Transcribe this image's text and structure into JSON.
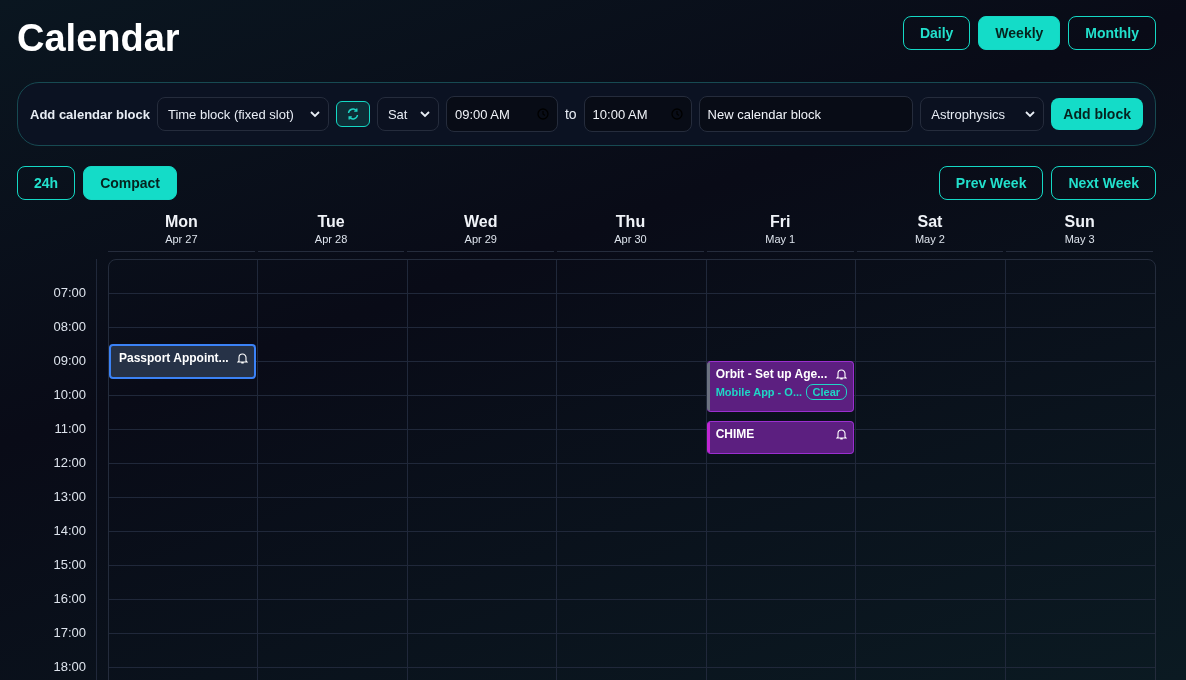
{
  "title": "Calendar",
  "views": [
    {
      "label": "Daily",
      "selected": false
    },
    {
      "label": "Weekly",
      "selected": true
    },
    {
      "label": "Monthly",
      "selected": false
    }
  ],
  "add_block": {
    "label": "Add calendar block",
    "block_type": "Time block (fixed slot)",
    "day": "Sat",
    "start_time": "09:00 AM",
    "to_label": "to",
    "end_time": "10:00 AM",
    "name_value": "New calendar block",
    "category": "Astrophysics",
    "submit": "Add block"
  },
  "toggles": [
    {
      "label": "24h",
      "selected": false
    },
    {
      "label": "Compact",
      "selected": true
    }
  ],
  "nav": [
    "Prev Week",
    "Next Week"
  ],
  "days": [
    {
      "name": "Mon",
      "date": "Apr 27",
      "events": [
        {
          "kind": "appointment",
          "title": "Passport Appoint...",
          "color": "#3b82f6"
        }
      ]
    },
    {
      "name": "Tue",
      "date": "Apr 28"
    },
    {
      "name": "Wed",
      "date": "Apr 29"
    },
    {
      "name": "Thu",
      "date": "Apr 30"
    },
    {
      "name": "Fri",
      "date": "May 1",
      "events": [
        {
          "kind": "task",
          "title": "Orbit - Set up Age...",
          "subtitle": "Mobile App - O...",
          "action": "Clear",
          "color": "#6b7280"
        },
        {
          "kind": "task",
          "title": "CHIME",
          "color": "#c026d3"
        }
      ]
    },
    {
      "name": "Sat",
      "date": "May 2"
    },
    {
      "name": "Sun",
      "date": "May 3"
    }
  ],
  "hours": [
    "07:00",
    "08:00",
    "09:00",
    "10:00",
    "11:00",
    "12:00",
    "13:00",
    "14:00",
    "15:00",
    "16:00",
    "17:00",
    "18:00"
  ]
}
